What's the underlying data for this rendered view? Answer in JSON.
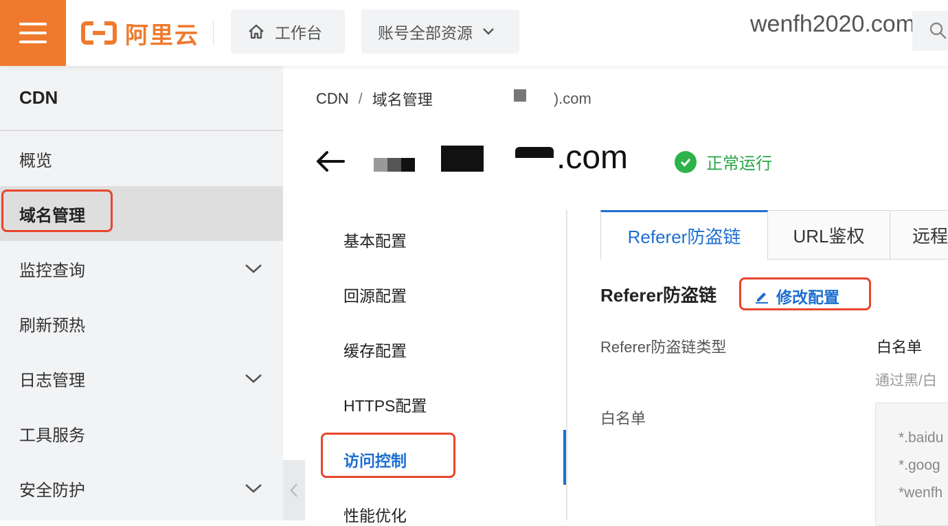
{
  "topbar": {
    "brand": "阿里云",
    "workbench_label": "工作台",
    "account_resources_label": "账号全部资源",
    "account_name": "wenfh2020.com"
  },
  "sidebar": {
    "title": "CDN",
    "items": [
      {
        "label": "概览",
        "expandable": false
      },
      {
        "label": "域名管理",
        "expandable": false,
        "active": true
      },
      {
        "label": "监控查询",
        "expandable": true
      },
      {
        "label": "刷新预热",
        "expandable": false
      },
      {
        "label": "日志管理",
        "expandable": true
      },
      {
        "label": "工具服务",
        "expandable": false
      },
      {
        "label": "安全防护",
        "expandable": true
      }
    ]
  },
  "breadcrumb": {
    "root": "CDN",
    "section": "域名管理",
    "current_suffix": ").com"
  },
  "header": {
    "domain_suffix": ".com",
    "status": "正常运行"
  },
  "subnav": {
    "items": [
      {
        "label": "基本配置"
      },
      {
        "label": "回源配置"
      },
      {
        "label": "缓存配置"
      },
      {
        "label": "HTTPS配置"
      },
      {
        "label": "访问控制",
        "active": true
      },
      {
        "label": "性能优化"
      }
    ]
  },
  "tabs": [
    {
      "label": "Referer防盗链",
      "active": true
    },
    {
      "label": "URL鉴权"
    },
    {
      "label": "远程"
    }
  ],
  "referer": {
    "section_title": "Referer防盗链",
    "edit_label": "修改配置",
    "type_label": "Referer防盗链类型",
    "type_value": "白名单",
    "type_hint": "通过黑/白",
    "whitelist_label": "白名单",
    "whitelist_entries": [
      "*.baidu",
      "*.goog",
      "*wenfh"
    ]
  },
  "colors": {
    "brand_orange": "#ef7a2d",
    "link_blue": "#1d6fd1",
    "highlight_red": "#e8452c",
    "status_green": "#2db34a"
  }
}
